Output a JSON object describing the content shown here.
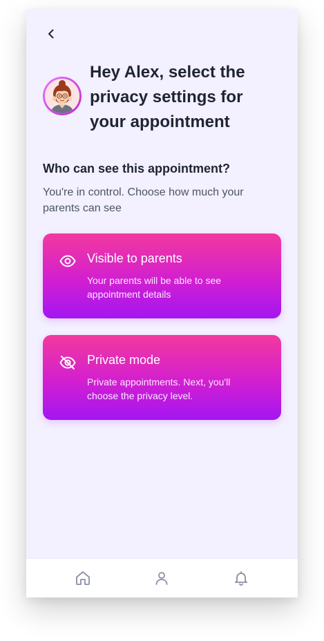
{
  "header": {
    "back_icon": "chevron-left-icon",
    "title": "Hey Alex, select the privacy settings for your appointment"
  },
  "section": {
    "heading": "Who can see this appointment?",
    "subtitle": "You're in control. Choose how much your parents can see"
  },
  "options": [
    {
      "icon": "eye-icon",
      "title": "Visible to parents",
      "description": "Your parents will be able to see appointment details"
    },
    {
      "icon": "eye-off-icon",
      "title": "Private mode",
      "description": "Private appointments. Next, you'll choose the privacy level."
    }
  ],
  "bottom_nav": {
    "items": [
      "home-icon",
      "profile-icon",
      "bell-icon"
    ]
  },
  "colors": {
    "background": "#f3f0ff",
    "card_gradient_top": "#f2399e",
    "card_gradient_bottom": "#a316f2",
    "title_text": "#1e2433",
    "nav_icon": "#8a8fa3"
  }
}
